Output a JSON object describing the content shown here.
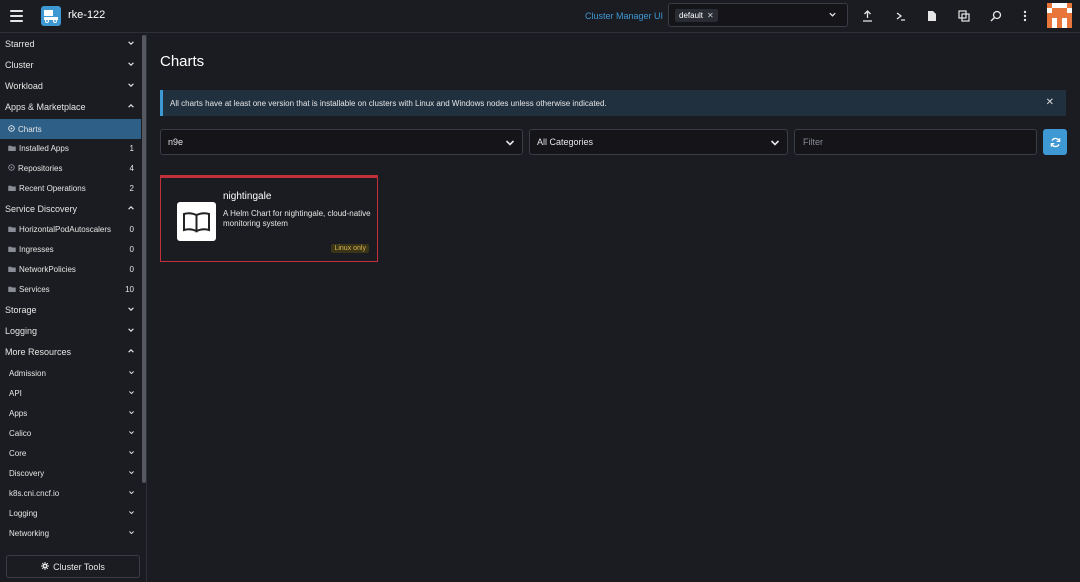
{
  "header": {
    "cluster_name": "rke-122",
    "cluster_manager_link": "Cluster Manager UI",
    "namespace_tag": "default",
    "icons": [
      "upload-icon",
      "terminal-icon",
      "file-icon",
      "copy-icon",
      "search-icon",
      "more-icon"
    ]
  },
  "sidebar": {
    "groups": {
      "starred": "Starred",
      "cluster": "Cluster",
      "workload": "Workload",
      "apps": "Apps & Marketplace",
      "service_discovery": "Service Discovery",
      "storage": "Storage",
      "logging": "Logging",
      "more_resources": "More Resources"
    },
    "apps_items": [
      {
        "label": "Charts",
        "count": ""
      },
      {
        "label": "Installed Apps",
        "count": "1"
      },
      {
        "label": "Repositories",
        "count": "4"
      },
      {
        "label": "Recent Operations",
        "count": "2"
      }
    ],
    "sd_items": [
      {
        "label": "HorizontalPodAutoscalers",
        "count": "0"
      },
      {
        "label": "Ingresses",
        "count": "0"
      },
      {
        "label": "NetworkPolicies",
        "count": "0"
      },
      {
        "label": "Services",
        "count": "10"
      }
    ],
    "more_items": [
      "Admission",
      "API",
      "Apps",
      "Calico",
      "Core",
      "Discovery",
      "k8s.cni.cncf.io",
      "Logging",
      "Networking"
    ],
    "cluster_tools": "Cluster Tools"
  },
  "main": {
    "title": "Charts",
    "banner": "All charts have at least one version that is installable on clusters with Linux and Windows nodes unless otherwise indicated.",
    "repo_select": "n9e",
    "category_select": "All Categories",
    "filter_placeholder": "Filter",
    "card": {
      "title": "nightingale",
      "description": "A Helm Chart for nightingale, cloud-native monitoring system",
      "badge": "Linux only"
    }
  },
  "colors": {
    "accent": "#3d98d3",
    "active_item": "#2d5f87",
    "card_border": "#c0303a",
    "badge_text": "#d9b14b"
  }
}
